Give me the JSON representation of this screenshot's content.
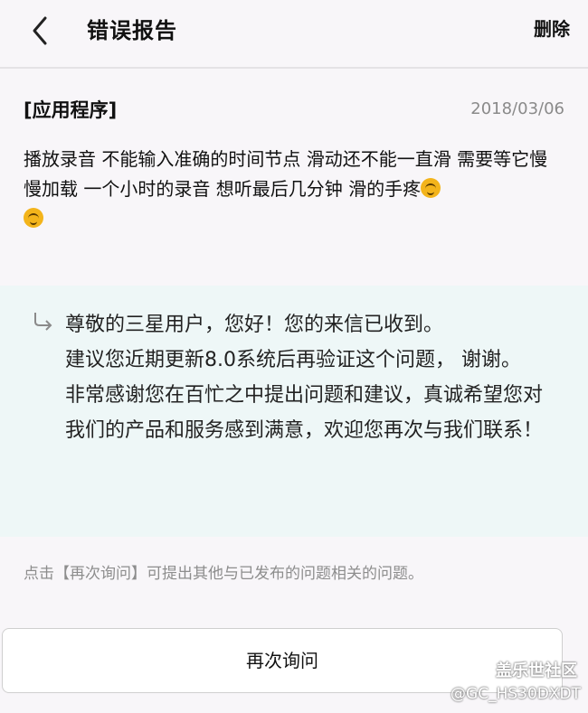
{
  "header": {
    "title": "错误报告",
    "delete_label": "删除"
  },
  "report": {
    "category": "[应用程序]",
    "date": "2018/03/06",
    "body": "播放录音 不能输入准确的时间节点 滑动还不能一直滑 需要等它慢慢加载 一个小时的录音 想听最后几分钟 滑的手疼"
  },
  "reply": {
    "line1": "尊敬的三星用户，您好！您的来信已收到。",
    "line2": "建议您近期更新8.0系统后再验证这个问题， 谢谢。",
    "line3": "非常感谢您在百忙之中提出问题和建议，真诚希望您对我们的产品和服务感到满意，欢迎您再次与我们联系！"
  },
  "hint": "点击【再次询问】可提出其他与已发布的问题相关的问题。",
  "reask_label": "再次询问",
  "watermark": {
    "line1": "盖乐世社区",
    "line2": "@GC_HS30DXDT"
  },
  "icons": {
    "back": "back-chevron-icon",
    "reply": "reply-arrow-icon",
    "emoji": "upside-down-face-emoji"
  },
  "colors": {
    "reply_background": "#eef7f7",
    "page_background": "#f8f6f9"
  }
}
